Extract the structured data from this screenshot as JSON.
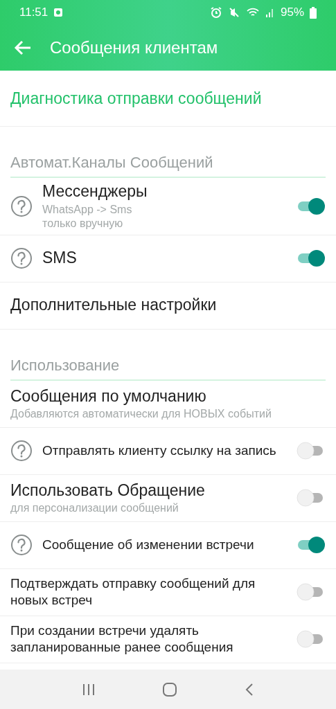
{
  "status_bar": {
    "time": "11:51",
    "battery": "95%"
  },
  "app_bar": {
    "title": "Сообщения клиентам"
  },
  "items": [
    {
      "kind": "link",
      "title": "Диагностика отправки сообщений"
    },
    {
      "kind": "header",
      "title": "Автомат.Каналы Сообщений"
    },
    {
      "kind": "setting",
      "title": "Мессенджеры",
      "subtitle": "WhatsApp -> Sms\nтолько вручную",
      "help": true,
      "on": true
    },
    {
      "kind": "setting",
      "title": "SMS",
      "help": true,
      "on": true
    },
    {
      "kind": "setting",
      "title": "Дополнительные настройки",
      "help": false
    },
    {
      "kind": "header",
      "title": "Использование"
    },
    {
      "kind": "setting",
      "title": "Сообщения по умолчанию",
      "subtitle": "Добавляются автоматически для НОВЫХ событий",
      "help": false
    },
    {
      "kind": "option",
      "title": "Отправлять клиенту ссылку на запись",
      "help": true,
      "on": false
    },
    {
      "kind": "setting",
      "title": "Использовать Обращение",
      "subtitle": "для персонализации сообщений",
      "help": false,
      "on": false
    },
    {
      "kind": "option",
      "title": "Сообщение об изменении встречи",
      "help": true,
      "on": true
    },
    {
      "kind": "option",
      "title": "Подтверждать отправку сообщений для новых встреч",
      "help": false,
      "on": false
    },
    {
      "kind": "option",
      "title": "При создании встречи удалять запланированные ранее сообщения",
      "help": false,
      "on": false
    }
  ]
}
